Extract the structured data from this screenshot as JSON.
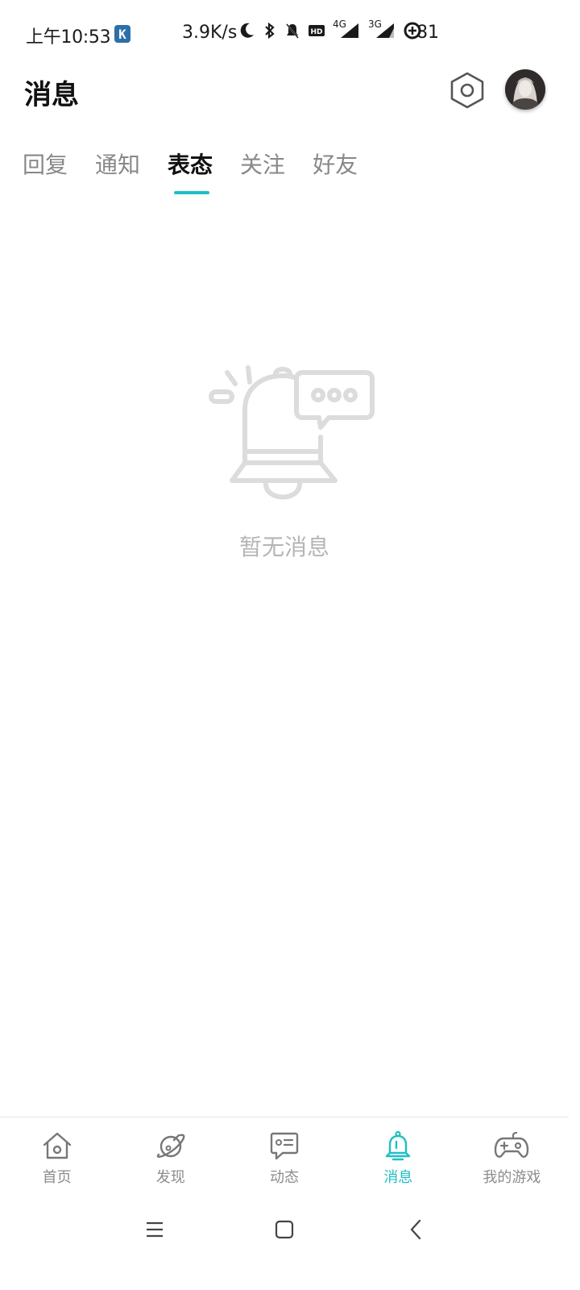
{
  "status_bar": {
    "time": "上午10:53",
    "k_badge": "K",
    "net_speed": "3.9K/s",
    "network_labels": [
      "4G",
      "3G"
    ],
    "battery": "81",
    "icons": [
      "moon-icon",
      "bluetooth-icon",
      "mute-icon",
      "hd-icon",
      "signal-4g-icon",
      "signal-3g-icon",
      "battery-saver-icon"
    ]
  },
  "header": {
    "title": "消息"
  },
  "tabs": [
    {
      "label": "回复",
      "active": false
    },
    {
      "label": "通知",
      "active": false
    },
    {
      "label": "表态",
      "active": true
    },
    {
      "label": "关注",
      "active": false
    },
    {
      "label": "好友",
      "active": false
    }
  ],
  "empty_state": {
    "text": "暂无消息",
    "icon": "bell-chat-illustration"
  },
  "bottom_nav": {
    "items": [
      {
        "label": "首页",
        "icon": "home-icon",
        "active": false
      },
      {
        "label": "发现",
        "icon": "planet-icon",
        "active": false
      },
      {
        "label": "动态",
        "icon": "feed-chat-icon",
        "active": false
      },
      {
        "label": "消息",
        "icon": "bell-icon",
        "active": true
      },
      {
        "label": "我的游戏",
        "icon": "gamepad-icon",
        "active": false
      }
    ]
  },
  "colors": {
    "accent": "#1fbfc4",
    "text_primary": "#111111",
    "text_inactive": "#888888",
    "empty_text": "#b5b5b5"
  }
}
